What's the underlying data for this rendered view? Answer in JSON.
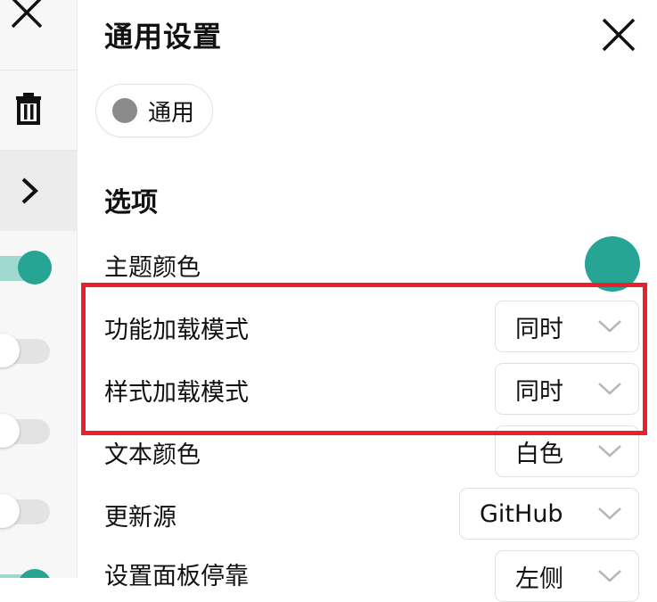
{
  "panel": {
    "title": "通用设置",
    "tab_chip": {
      "label": "通用",
      "dot_color": "#8a8a8a"
    },
    "section_title": "选项",
    "rows": [
      {
        "label": "主题颜色",
        "control": "color",
        "value": "#26a595"
      },
      {
        "label": "功能加载模式",
        "control": "select",
        "value": "同时"
      },
      {
        "label": "样式加载模式",
        "control": "select",
        "value": "同时"
      },
      {
        "label": "文本颜色",
        "control": "select",
        "value": "白色"
      },
      {
        "label": "更新源",
        "control": "select",
        "value": "GitHub"
      },
      {
        "label": "设置面板停靠",
        "control": "select",
        "value": "左侧"
      }
    ]
  },
  "left_strip": {
    "icons": [
      "close-icon",
      "trash-icon",
      "chevron-right-icon"
    ],
    "toggles": [
      {
        "state": "on"
      },
      {
        "state": "off"
      },
      {
        "state": "off"
      },
      {
        "state": "off"
      },
      {
        "state": "on"
      }
    ]
  },
  "colors": {
    "accent": "#26a595",
    "highlight": "#e8212b"
  }
}
